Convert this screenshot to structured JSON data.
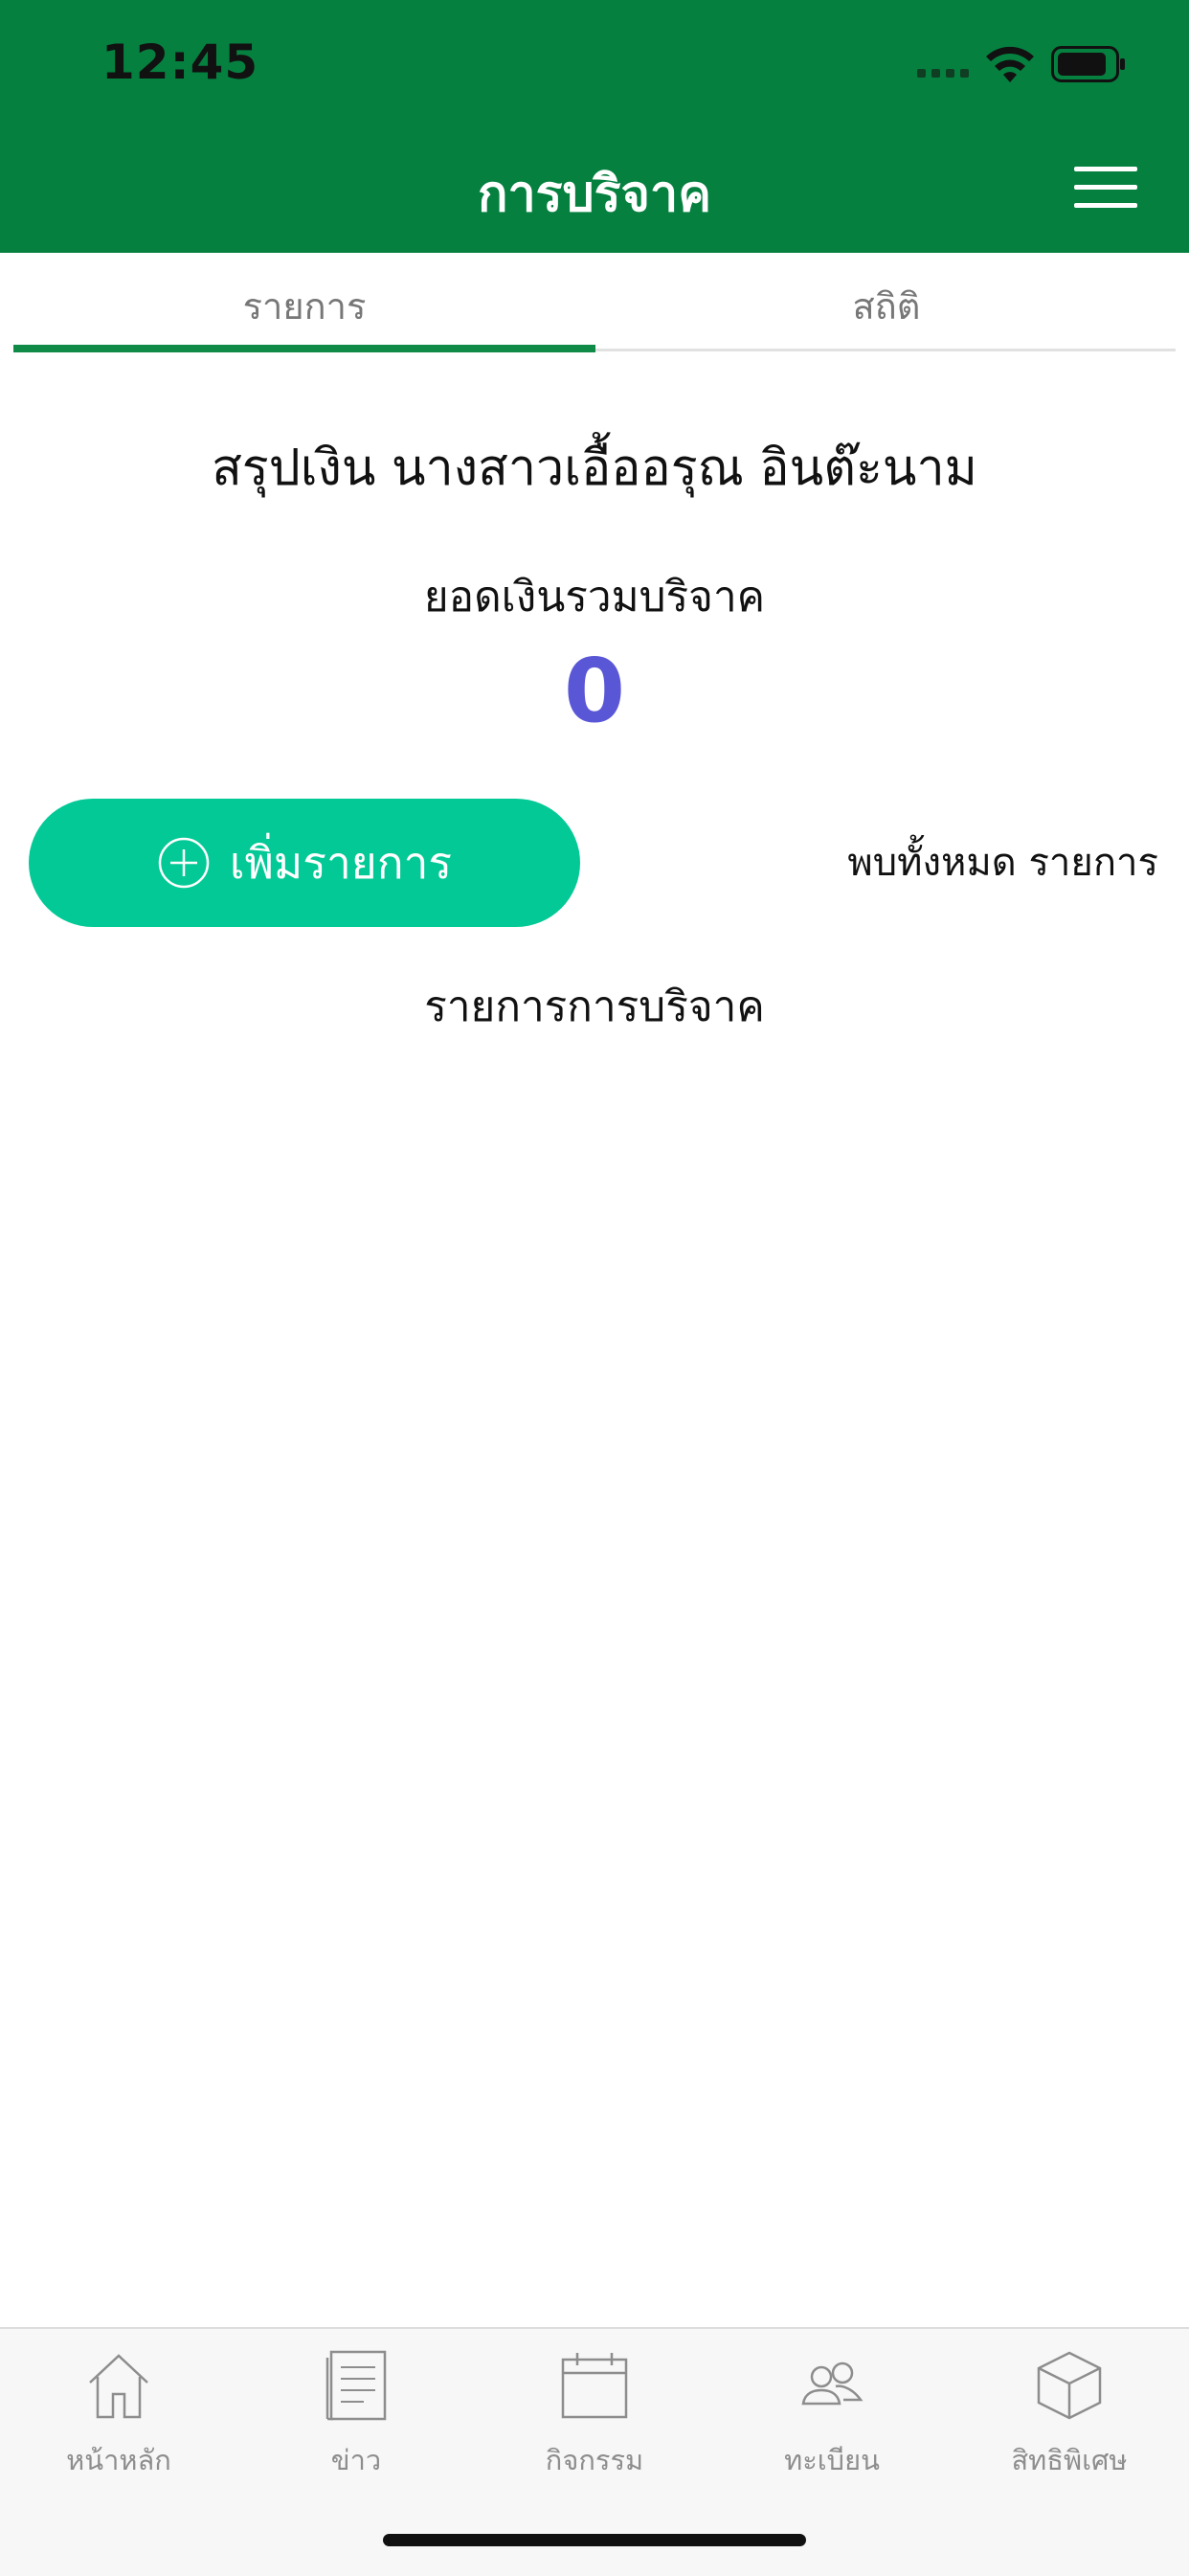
{
  "status_bar": {
    "time": "12:45"
  },
  "header": {
    "title": "การบริจาค",
    "menu_icon": "hamburger-icon"
  },
  "tabs": [
    {
      "label": "รายการ",
      "active": true
    },
    {
      "label": "สถิติ",
      "active": false
    }
  ],
  "summary": {
    "title": "สรุปเงิน นางสาวเอื้ออรุณ อินต๊ะนาม",
    "total_label": "ยอดเงินรวมบริจาค",
    "total_value": "0"
  },
  "actions": {
    "add_label": "เพิ่มรายการ",
    "found_text": "พบทั้งหมด รายการ"
  },
  "list": {
    "heading": "รายการการบริจาค"
  },
  "bottom_nav": [
    {
      "label": "หน้าหลัก",
      "icon": "home-icon"
    },
    {
      "label": "ข่าว",
      "icon": "news-icon"
    },
    {
      "label": "กิจกรรม",
      "icon": "calendar-icon"
    },
    {
      "label": "ทะเบียน",
      "icon": "people-icon"
    },
    {
      "label": "สิทธิพิเศษ",
      "icon": "box-icon"
    }
  ],
  "colors": {
    "header_bg": "#05803f",
    "tab_indicator": "#0f8a47",
    "add_button_bg": "#03c996",
    "total_value": "#5a57d6"
  }
}
